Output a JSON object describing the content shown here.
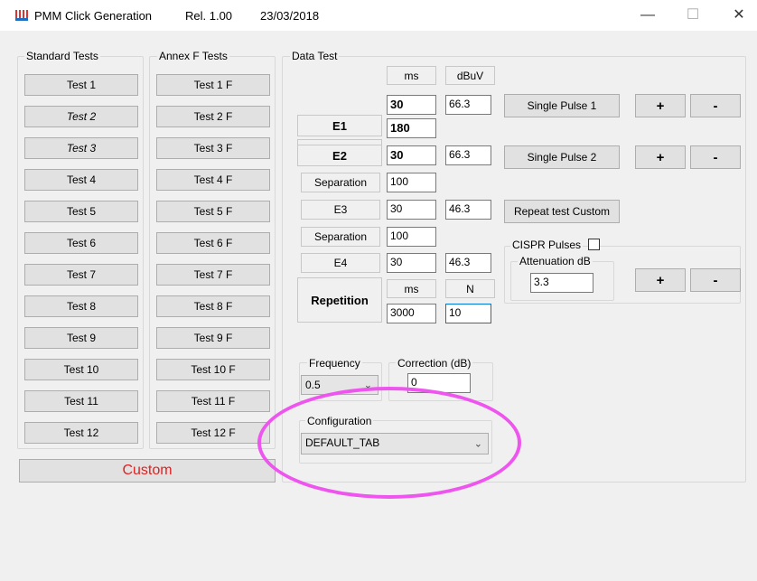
{
  "window": {
    "title": "PMM Click Generation",
    "release": "Rel. 1.00",
    "date": "23/03/2018",
    "minimize": "—",
    "maximize": "☐",
    "close": "✕"
  },
  "standard_tests": {
    "label": "Standard  Tests",
    "buttons": [
      "Test 1",
      "Test 2",
      "Test 3",
      "Test 4",
      "Test 5",
      "Test 6",
      "Test 7",
      "Test 8",
      "Test 9",
      "Test 10",
      "Test 11",
      "Test 12"
    ]
  },
  "annex_tests": {
    "label": "Annex F Tests",
    "buttons": [
      "Test 1 F",
      "Test 2 F",
      "Test 3 F",
      "Test 4 F",
      "Test 5 F",
      "Test 6 F",
      "Test 7 F",
      "Test 8 F",
      "Test 9 F",
      "Test 10 F",
      "Test 11 F",
      "Test 12 F"
    ]
  },
  "custom_button": "Custom",
  "data_test": {
    "label": "Data Test",
    "col_ms": "ms",
    "col_dbuv": "dBuV",
    "e1": {
      "label": "E1",
      "ms": "30",
      "dbuv": "66.3"
    },
    "sep1": {
      "label": "Separation",
      "ms": "180"
    },
    "e2": {
      "label": "E2",
      "ms": "30",
      "dbuv": "66.3"
    },
    "sep2": {
      "label": "Separation",
      "ms": "100"
    },
    "e3": {
      "label": "E3",
      "ms": "30",
      "dbuv": "46.3"
    },
    "sep3": {
      "label": "Separation",
      "ms": "100"
    },
    "e4": {
      "label": "E4",
      "ms": "30",
      "dbuv": "46.3"
    },
    "repetition": {
      "label": "Repetition",
      "col_ms": "ms",
      "col_n": "N",
      "ms": "3000",
      "n": "10"
    },
    "single_pulse_1": "Single Pulse 1",
    "single_pulse_2": "Single Pulse 2",
    "repeat_test_custom": "Repeat test Custom",
    "plus": "+",
    "minus": "-",
    "cispr_pulses": "CISPR Pulses",
    "attenuation_label": "Attenuation dB",
    "attenuation_value": "3.3",
    "frequency_label": "Frequency",
    "frequency_value": "0.5",
    "correction_label": "Correction (dB)",
    "correction_value": "0",
    "configuration_label": "Configuration",
    "configuration_value": "DEFAULT_TAB"
  },
  "colors": {
    "custom_text": "#e02020",
    "annotation": "#ee55ee",
    "focus_border": "#0078d7"
  }
}
